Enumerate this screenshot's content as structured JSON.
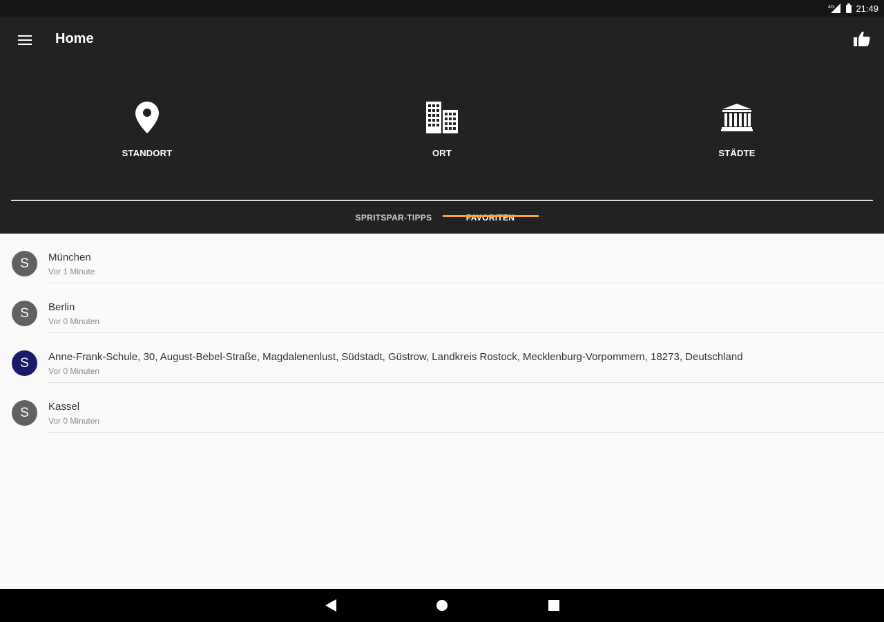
{
  "status_bar": {
    "time": "21:49"
  },
  "app_bar": {
    "title": "Home"
  },
  "shortcuts": [
    {
      "label": "STANDORT",
      "icon": "location-pin-icon"
    },
    {
      "label": "ORT",
      "icon": "buildings-icon"
    },
    {
      "label": "STÄDTE",
      "icon": "museum-icon"
    }
  ],
  "tabs": [
    {
      "label": "SPRITSPAR-TIPPS",
      "selected": false
    },
    {
      "label": "FAVORITEN",
      "selected": true
    }
  ],
  "favorites": [
    {
      "avatar": "S",
      "title": "München",
      "subtitle": "Vor 1 Minute",
      "avatar_color": "#616161"
    },
    {
      "avatar": "S",
      "title": "Berlin",
      "subtitle": "Vor 0 Minuten",
      "avatar_color": "#616161"
    },
    {
      "avatar": "S",
      "title": "Anne-Frank-Schule, 30, August-Bebel-Straße, Magdalenenlust, Südstadt, Güstrow, Landkreis Rostock, Mecklenburg-Vorpommern, 18273, Deutschland",
      "subtitle": "Vor 0 Minuten",
      "avatar_color": "#1a1a6b"
    },
    {
      "avatar": "S",
      "title": "Kassel",
      "subtitle": "Vor 0 Minuten",
      "avatar_color": "#616161"
    }
  ],
  "colors": {
    "app_bar": "#222222",
    "tab_indicator": "#f9a825",
    "background": "#fafafa"
  }
}
